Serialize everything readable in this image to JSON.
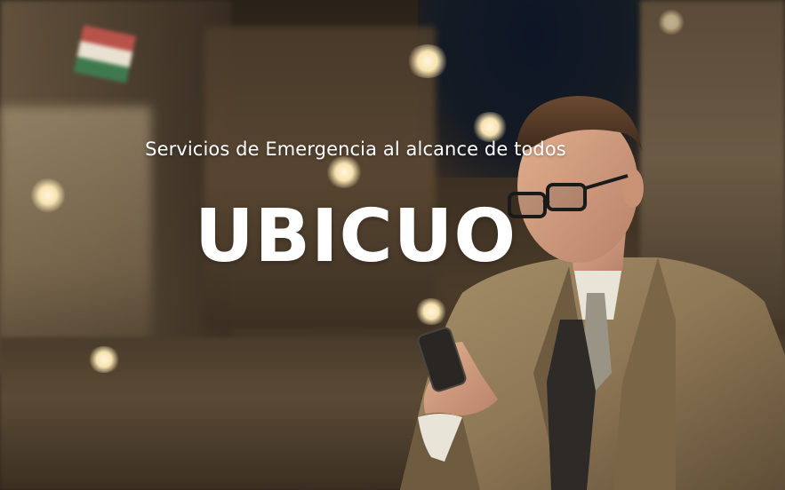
{
  "hero": {
    "tagline": "Servicios de Emergencia al alcance de todos",
    "brand_name": "UBICUO",
    "text_color": "#ffffff"
  },
  "background": {
    "description_icon": "night-street-photo"
  }
}
